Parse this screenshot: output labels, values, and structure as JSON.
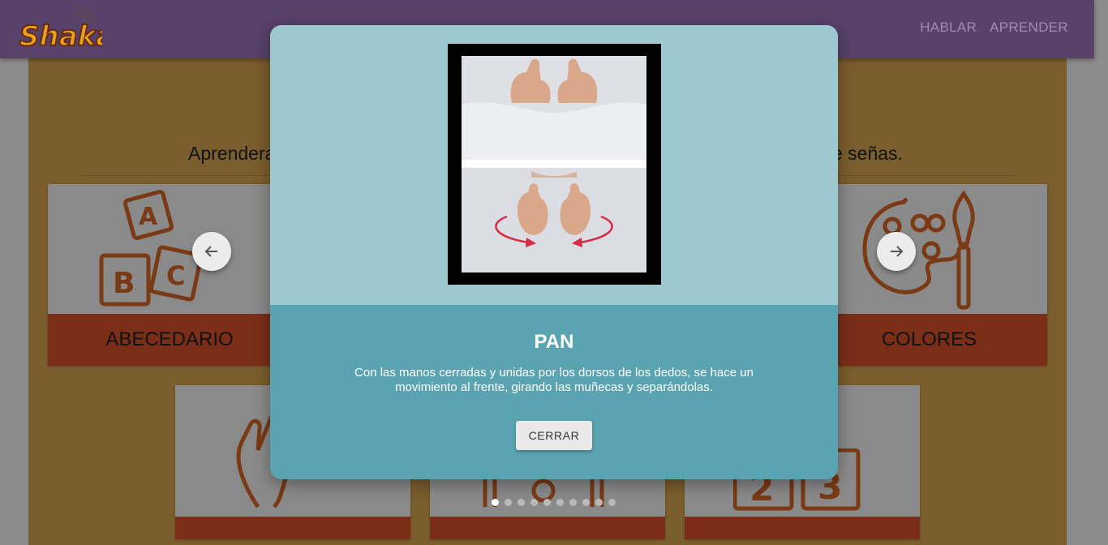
{
  "nav": {
    "logo_text": "Shaka",
    "links": [
      {
        "label": "HABLAR"
      },
      {
        "label": "APRENDER"
      }
    ]
  },
  "intro": {
    "text_left": "Aprendera",
    "text_right": "e señas."
  },
  "categories": [
    {
      "label": "ABECEDARIO",
      "icon": "abc-blocks-icon"
    },
    {
      "label": "COLORES",
      "icon": "palette-icon"
    }
  ],
  "modal": {
    "title": "PAN",
    "description": "Con las manos cerradas y unidas por los dorsos de los dedos, se hace un movimiento al frente, girando las muñecas y separándolas.",
    "close_label": "CERRAR"
  },
  "carousel": {
    "total": 10,
    "active_index": 0
  },
  "colors": {
    "navbar": "#58416b",
    "modal_top": "#9ec8d0",
    "modal_bottom": "#5aa3b0",
    "card_caption": "#7a2e18"
  }
}
